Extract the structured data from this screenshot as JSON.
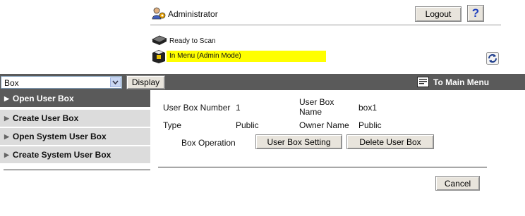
{
  "header": {
    "user_label": "Administrator",
    "logout_label": "Logout",
    "help_label": "?",
    "status_ready": "Ready to Scan",
    "status_menu": "In Menu (Admin Mode)"
  },
  "nav": {
    "select_value": "Box",
    "display_label": "Display",
    "main_menu_label": "To Main Menu"
  },
  "sidebar": {
    "items": [
      {
        "label": "Open User Box"
      },
      {
        "label": "Create User Box"
      },
      {
        "label": "Open System User Box"
      },
      {
        "label": "Create System User Box"
      }
    ]
  },
  "details": {
    "box_number_label": "User Box Number",
    "box_number_value": "1",
    "box_name_label_line1": "User Box",
    "box_name_label_line2": "Name",
    "box_name_value": "box1",
    "type_label": "Type",
    "type_value": "Public",
    "owner_label": "Owner Name",
    "owner_value": "Public",
    "operation_label": "Box Operation",
    "setting_button": "User Box Setting",
    "delete_button": "Delete User Box",
    "cancel_button": "Cancel"
  },
  "colors": {
    "bar": "#5a5a5a",
    "highlight": "#ffff00",
    "sidebar": "#dcdcdc"
  }
}
